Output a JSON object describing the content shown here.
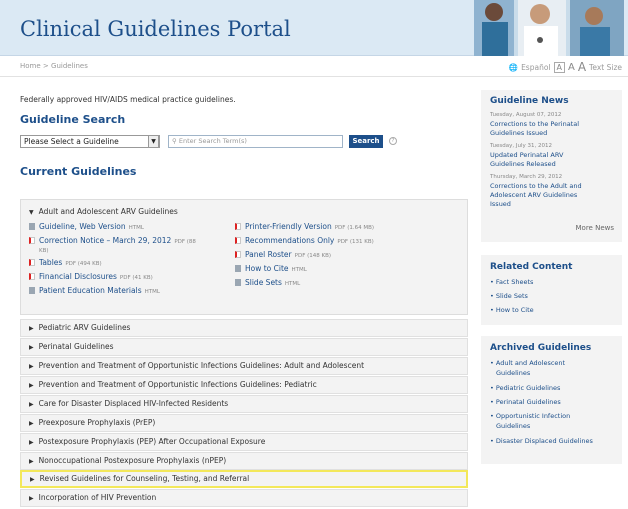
{
  "header": {
    "title": "Clinical Guidelines Portal"
  },
  "topbar": {
    "breadcrumb_home": "Home",
    "breadcrumb_sep": ">",
    "breadcrumb_current": "Guidelines",
    "espanol": "Español",
    "text_size_small": "A",
    "text_size_mid": "A",
    "text_size_big": "A",
    "text_size_label": "Text Size"
  },
  "main": {
    "intro": "Federally approved HIV/AIDS medical practice guidelines.",
    "search_heading": "Guideline Search",
    "select_value": "Please Select a Guideline",
    "search_placeholder": "Enter Search Term(s)",
    "search_button": "Search",
    "help_icon": "?",
    "current_heading": "Current Guidelines"
  },
  "open_section": {
    "title": "Adult and Adolescent ARV Guidelines",
    "left_links": [
      {
        "label": "Guideline, Web Version",
        "meta": "HTML",
        "icon": "html-page-icon"
      },
      {
        "label": "Correction Notice – March 29, 2012",
        "meta": "PDF (88",
        "meta2": "KB)",
        "icon": "pdf-icon"
      },
      {
        "label": "Tables",
        "meta": "PDF (494 KB)",
        "icon": "pdf-icon"
      },
      {
        "label": "Financial Disclosures",
        "meta": "PDF (41 KB)",
        "icon": "pdf-icon"
      },
      {
        "label": "Patient Education Materials",
        "meta": "HTML",
        "icon": "html-page-icon"
      }
    ],
    "right_links": [
      {
        "label": "Printer-Friendly Version",
        "meta": "PDF (1.64 MB)",
        "icon": "pdf-icon"
      },
      {
        "label": "Recommendations Only",
        "meta": "PDF (131 KB)",
        "icon": "pdf-icon"
      },
      {
        "label": "Panel Roster",
        "meta": "PDF (148 KB)",
        "icon": "pdf-icon"
      },
      {
        "label": "How to Cite",
        "meta": "HTML",
        "icon": "html-page-icon"
      },
      {
        "label": "Slide Sets",
        "meta": "HTML",
        "icon": "html-page-icon"
      }
    ]
  },
  "collapsed_sections": [
    "Pediatric ARV Guidelines",
    "Perinatal Guidelines",
    "Prevention and Treatment of Opportunistic Infections Guidelines: Adult and Adolescent",
    "Prevention and Treatment of Opportunistic Infections Guidelines: Pediatric",
    "Care for Disaster Displaced HIV-Infected Residents",
    "Preexposure Prophylaxis (PrEP)",
    "Postexposure Prophylaxis (PEP) After Occupational Exposure",
    "Nonoccupational Postexposure Prophylaxis (nPEP)",
    "Revised Guidelines for Counseling, Testing, and Referral",
    "Incorporation of HIV Prevention"
  ],
  "news": {
    "title": "Guideline News",
    "items": [
      {
        "date": "Tuesday, August 07, 2012",
        "line1": "Corrections to the Perinatal",
        "line2": "Guidelines Issued"
      },
      {
        "date": "Tuesday, July 31, 2012",
        "line1": "Updated Perinatal ARV",
        "line2": "Guidelines Released"
      },
      {
        "date": "Thursday, March 29, 2012",
        "line1": "Corrections to the Adult and",
        "line2": "Adolescent ARV Guidelines",
        "line3": "Issued"
      }
    ],
    "more": "More News"
  },
  "related": {
    "title": "Related Content",
    "items": [
      "Fact Sheets",
      "Slide Sets",
      "How to Cite"
    ]
  },
  "archived": {
    "title": "Archived Guidelines",
    "items": [
      {
        "line1": "Adult and Adolescent",
        "line2": "Guidelines"
      },
      {
        "line1": "Pediatric Guidelines"
      },
      {
        "line1": "Perinatal Guidelines"
      },
      {
        "line1": "Opportunistic Infection",
        "line2": "Guidelines"
      },
      {
        "line1": "Disaster Displaced Guidelines"
      }
    ]
  },
  "colors": {
    "brand_blue": "#1d4f8a",
    "header_bg": "#dbe9f4",
    "highlight": "#f3e85a",
    "panel_bg": "#f3f3f3"
  }
}
